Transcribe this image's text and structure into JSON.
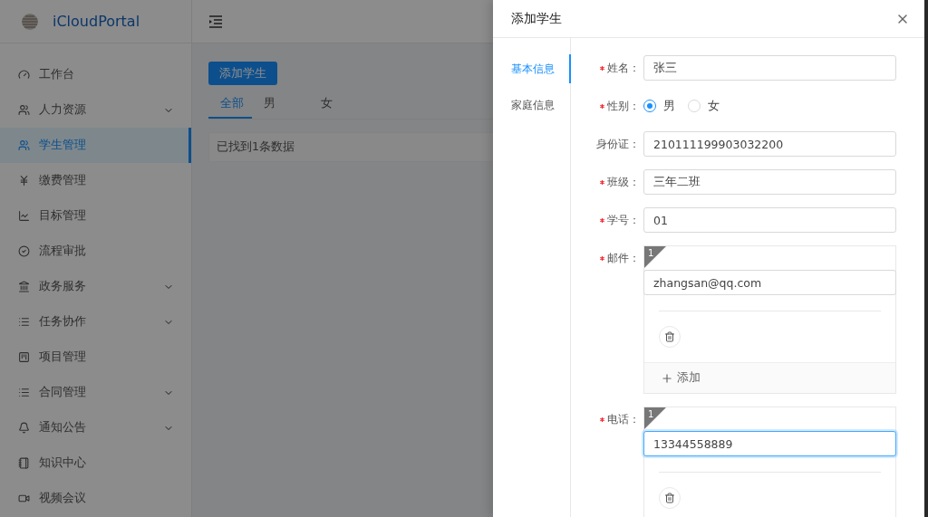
{
  "app": {
    "brand": "iCloudPortal"
  },
  "sidebar": {
    "items": [
      {
        "label": "工作台",
        "expandable": false,
        "selected": false
      },
      {
        "label": "人力资源",
        "expandable": true,
        "selected": false
      },
      {
        "label": "学生管理",
        "expandable": false,
        "selected": true
      },
      {
        "label": "缴费管理",
        "expandable": false,
        "selected": false
      },
      {
        "label": "目标管理",
        "expandable": false,
        "selected": false
      },
      {
        "label": "流程审批",
        "expandable": false,
        "selected": false
      },
      {
        "label": "政务服务",
        "expandable": true,
        "selected": false
      },
      {
        "label": "任务协作",
        "expandable": true,
        "selected": false
      },
      {
        "label": "项目管理",
        "expandable": false,
        "selected": false
      },
      {
        "label": "合同管理",
        "expandable": true,
        "selected": false
      },
      {
        "label": "通知公告",
        "expandable": true,
        "selected": false
      },
      {
        "label": "知识中心",
        "expandable": false,
        "selected": false
      },
      {
        "label": "视频会议",
        "expandable": false,
        "selected": false
      }
    ]
  },
  "main": {
    "add_button": "添加学生",
    "tabs": [
      {
        "label": "全部",
        "selected": true
      },
      {
        "label": "男",
        "selected": false
      },
      {
        "label": "女",
        "selected": false
      }
    ],
    "result_text": "已找到1条数据"
  },
  "drawer": {
    "title": "添加学生",
    "anchors": [
      {
        "label": "基本信息",
        "selected": true
      },
      {
        "label": "家庭信息",
        "selected": false
      }
    ],
    "fields": [
      {
        "kind": "text",
        "label": "姓名：",
        "required": true,
        "value": "张三"
      },
      {
        "kind": "radio",
        "label": "性别：",
        "required": true,
        "options": [
          {
            "label": "男",
            "selected": true
          },
          {
            "label": "女",
            "selected": false
          }
        ]
      },
      {
        "kind": "text",
        "label": "身份证：",
        "required": false,
        "value": "210111199903032200"
      },
      {
        "kind": "text",
        "label": "班级：",
        "required": true,
        "value": "三年二班"
      },
      {
        "kind": "text",
        "label": "学号：",
        "required": true,
        "value": "01"
      },
      {
        "kind": "list",
        "label": "邮件：",
        "required": true,
        "items": [
          {
            "index": "1",
            "value": "zhangsan@qq.com",
            "focused": false
          }
        ],
        "add_label": "添加"
      },
      {
        "kind": "list",
        "label": "电话：",
        "required": true,
        "items": [
          {
            "index": "1",
            "value": "13344558889",
            "focused": true
          }
        ]
      }
    ]
  }
}
